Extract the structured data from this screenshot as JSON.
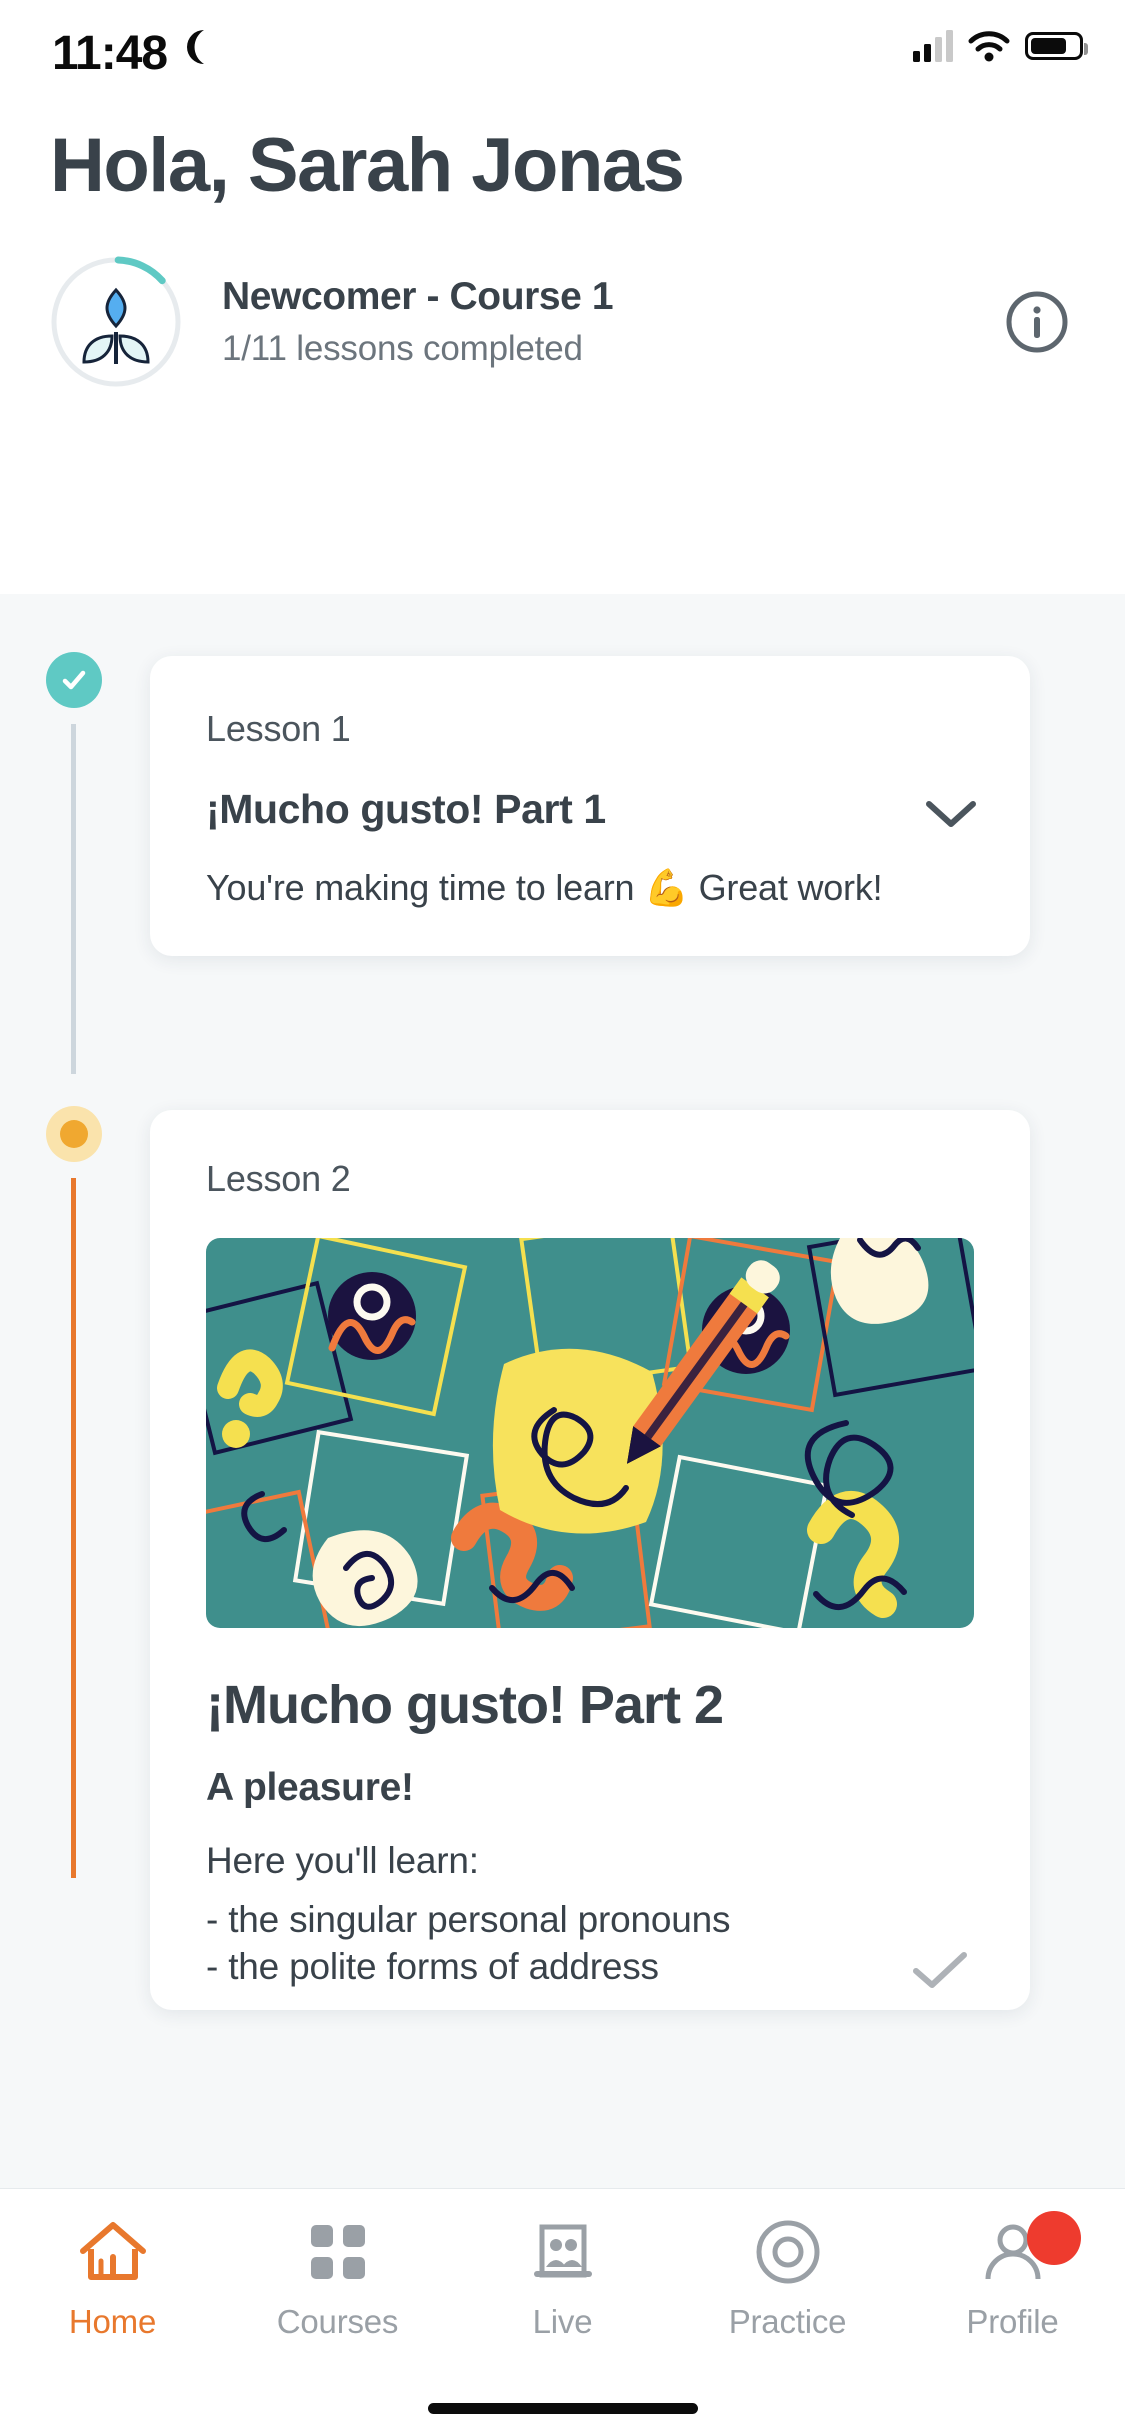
{
  "status_bar": {
    "time": "11:48",
    "dnd_icon": "crescent-moon-icon",
    "signal_icon": "cellular-signal-icon",
    "wifi_icon": "wifi-icon",
    "battery_icon": "battery-icon"
  },
  "header": {
    "greeting": "Hola, Sarah Jonas",
    "course_title": "Newcomer - Course 1",
    "course_progress": "1/11 lessons completed",
    "progress_percent": 9,
    "info_icon": "info-circle-icon",
    "badge_icon": "plant-sprout-icon"
  },
  "lessons": [
    {
      "kicker": "Lesson 1",
      "title": "¡Mucho gusto! Part 1",
      "description": "You're making time to learn 💪 Great work!",
      "status": "completed",
      "status_icon": "check-circle-icon",
      "expand_icon": "chevron-down-icon"
    },
    {
      "kicker": "Lesson 2",
      "title": "¡Mucho gusto! Part 2",
      "subtitle": "A pleasure!",
      "lead": "Here you'll learn:",
      "bullets": [
        "- the singular personal pronouns",
        "- the polite forms of address"
      ],
      "status": "current",
      "status_icon": "dot-circle-icon",
      "hero_icon": "study-illustration"
    }
  ],
  "tabs": [
    {
      "label": "Home",
      "icon": "home-icon",
      "active": true,
      "badge": false
    },
    {
      "label": "Courses",
      "icon": "grid-icon",
      "active": false,
      "badge": false
    },
    {
      "label": "Live",
      "icon": "live-people-icon",
      "active": false,
      "badge": false
    },
    {
      "label": "Practice",
      "icon": "target-icon",
      "active": false,
      "badge": false
    },
    {
      "label": "Profile",
      "icon": "person-icon",
      "active": false,
      "badge": true
    }
  ],
  "colors": {
    "accent_orange": "#e8782d",
    "teal": "#5fc9c4",
    "amber": "#f0a830",
    "text_dark": "#39424a",
    "text_muted": "#6c757d",
    "badge_red": "#ee3b2e",
    "hero_bg": "#3f8f8c"
  }
}
